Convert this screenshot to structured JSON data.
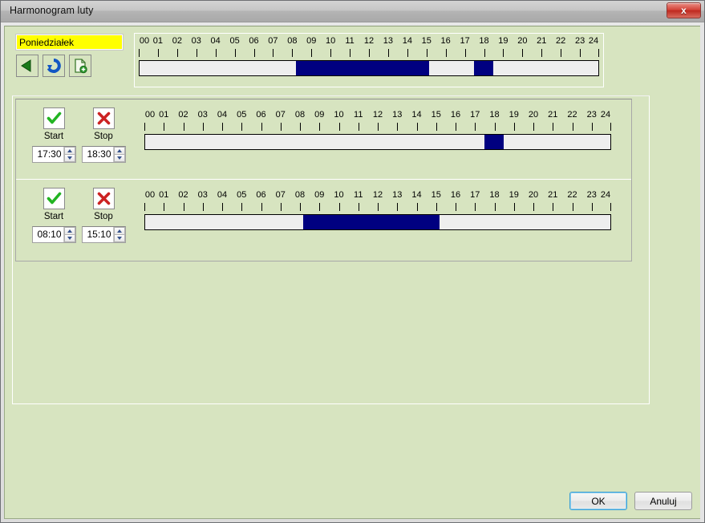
{
  "window": {
    "title": "Harmonogram luty",
    "close_label": "x"
  },
  "header": {
    "day_value": "Poniedziałek",
    "tools": [
      {
        "name": "back-icon",
        "label": "Poprzedni"
      },
      {
        "name": "refresh-icon",
        "label": "Odśwież"
      },
      {
        "name": "add-document-icon",
        "label": "Dodaj"
      }
    ]
  },
  "ruler": {
    "hours": [
      "00",
      "01",
      "02",
      "03",
      "04",
      "05",
      "06",
      "07",
      "08",
      "09",
      "10",
      "11",
      "12",
      "13",
      "14",
      "15",
      "16",
      "17",
      "18",
      "19",
      "20",
      "21",
      "22",
      "23",
      "24"
    ]
  },
  "colors": {
    "active_segment": "#000080",
    "bar_background": "#eeeeee",
    "client_background": "#d7e4c0",
    "day_field_background": "#ffff00"
  },
  "summary": {
    "segments": [
      {
        "start": "08:10",
        "end": "15:10"
      },
      {
        "start": "17:30",
        "end": "18:30"
      }
    ]
  },
  "rows": [
    {
      "start_label": "Start",
      "stop_label": "Stop",
      "start_value": "17:30",
      "stop_value": "18:30",
      "start_icon": "check-icon",
      "stop_icon": "cross-icon",
      "segments": [
        {
          "start": "17:30",
          "end": "18:30"
        }
      ]
    },
    {
      "start_label": "Start",
      "stop_label": "Stop",
      "start_value": "08:10",
      "stop_value": "15:10",
      "start_icon": "check-icon",
      "stop_icon": "cross-icon",
      "segments": [
        {
          "start": "08:10",
          "end": "15:10"
        }
      ]
    }
  ],
  "buttons": {
    "ok": "OK",
    "cancel": "Anuluj"
  }
}
